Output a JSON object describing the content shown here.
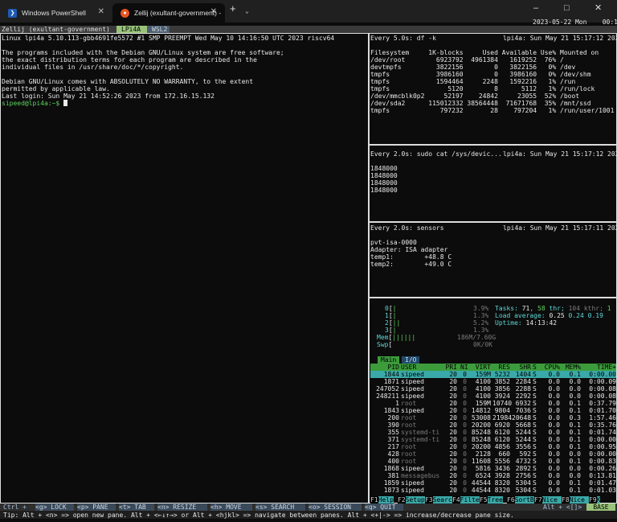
{
  "window": {
    "tabs": [
      {
        "label": "Windows PowerShell"
      },
      {
        "label": "Zellij (exultant-government) -"
      }
    ],
    "datetime": "2023-05-22 Mon    00:17"
  },
  "zellij": {
    "session": "Zellij (exultant-government)",
    "tabs": [
      "LPi4A",
      "WSL2"
    ]
  },
  "left_pane": {
    "lines": [
      "Linux lpi4a 5.10.113-gbb4691fe5572 #1 SMP PREEMPT Wed May 10 14:16:50 UTC 2023 riscv64",
      "",
      "The programs included with the Debian GNU/Linux system are free software;",
      "the exact distribution terms for each program are described in the",
      "individual files in /usr/share/doc/*/copyright.",
      "",
      "Debian GNU/Linux comes with ABSOLUTELY NO WARRANTY, to the extent",
      "permitted by applicable law.",
      "Last login: Sun May 21 14:52:26 2023 from 172.16.15.132"
    ],
    "prompt": "sipeed@lpi4a:~$ "
  },
  "df_pane": {
    "header_left": "Every 5.0s: df -k",
    "header_right": "lpi4a: Sun May 21 15:17:12 2023",
    "lines": [
      "Filesystem     1K-blocks     Used Available Use% Mounted on",
      "/dev/root        6923792  4961384   1619252  76% /",
      "devtmpfs         3822156        0   3822156   0% /dev",
      "tmpfs            3986160        0   3986160   0% /dev/shm",
      "tmpfs            1594464     2248   1592216   1% /run",
      "tmpfs               5120        8      5112   1% /run/lock",
      "/dev/mmcblk0p2     52197    24842     23055  52% /boot",
      "/dev/sda2      115012332 38564448  71671768  35% /mnt/ssd",
      "tmpfs             797232       28    797204   1% /run/user/1001"
    ]
  },
  "cat_pane": {
    "header_left": "Every 2.0s: sudo cat /sys/devic...",
    "header_right": "lpi4a: Sun May 21 15:17:12 2023",
    "lines": [
      "1848000",
      "1848000",
      "1848000",
      "1848000"
    ]
  },
  "sensors_pane": {
    "header_left": "Every 2.0s: sensors",
    "header_right": "lpi4a: Sun May 21 15:17:11 2023",
    "lines": [
      "pvt-isa-0000",
      "Adapter: ISA adapter",
      "temp1:        +48.8 C",
      "temp2:        +49.0 C"
    ]
  },
  "htop": {
    "cpus": [
      {
        "label": "0",
        "bar": "|",
        "value": "3.9%"
      },
      {
        "label": "1",
        "bar": "|",
        "value": "1.3%"
      },
      {
        "label": "2",
        "bar": "||",
        "value": "5.2%"
      },
      {
        "label": "3",
        "bar": "|",
        "value": "1.3%"
      }
    ],
    "mem": {
      "label": "Mem",
      "bar": "||||||",
      "value": "186M/7.60G"
    },
    "swp": {
      "label": "Swp",
      "bar": "",
      "value": "0K/0K"
    },
    "tasks_label": "Tasks:",
    "tasks": "71",
    "thr": "58",
    "thr_label": "thr;",
    "kthr": "104 kthr;",
    "running": "1",
    "load_label": "Load average:",
    "load1": "0.25",
    "load5": "0.24",
    "load15": "0.19",
    "uptime_label": "Uptime:",
    "uptime": "14:13:42",
    "tabs": [
      "Main",
      "I/O"
    ],
    "columns": [
      "PID",
      "USER",
      "PRI",
      "NI",
      "VIRT",
      "RES",
      "SHR",
      "S",
      "CPU%",
      "MEM%",
      "TIME+"
    ],
    "processes": [
      [
        "1844",
        "sipeed",
        "20",
        "0",
        "159M",
        "5232",
        "1404",
        "S",
        "0.0",
        "0.1",
        "0:00.00"
      ],
      [
        "1871",
        "sipeed",
        "20",
        "0",
        "4100",
        "3852",
        "2284",
        "S",
        "0.0",
        "0.0",
        "0:00.09"
      ],
      [
        "247052",
        "sipeed",
        "20",
        "0",
        "4100",
        "3856",
        "2288",
        "S",
        "0.0",
        "0.0",
        "0:00.08"
      ],
      [
        "248211",
        "sipeed",
        "20",
        "0",
        "4100",
        "3924",
        "2292",
        "S",
        "0.0",
        "0.0",
        "0:00.08"
      ],
      [
        "1",
        "root",
        "20",
        "0",
        "159M",
        "10740",
        "6932",
        "S",
        "0.0",
        "0.1",
        "0:37.79"
      ],
      [
        "1843",
        "sipeed",
        "20",
        "0",
        "14812",
        "9804",
        "7036",
        "S",
        "0.0",
        "0.1",
        "0:01.70"
      ],
      [
        "200",
        "root",
        "20",
        "0",
        "53008",
        "21984",
        "20648",
        "S",
        "0.0",
        "0.3",
        "1:57.46"
      ],
      [
        "390",
        "root",
        "20",
        "0",
        "20200",
        "6920",
        "5668",
        "S",
        "0.0",
        "0.1",
        "0:35.76"
      ],
      [
        "355",
        "systemd-ti",
        "20",
        "0",
        "85248",
        "6120",
        "5244",
        "S",
        "0.0",
        "0.1",
        "0:01.74"
      ],
      [
        "371",
        "systemd-ti",
        "20",
        "0",
        "85248",
        "6120",
        "5244",
        "S",
        "0.0",
        "0.1",
        "0:00.00"
      ],
      [
        "217",
        "root",
        "20",
        "0",
        "20200",
        "4856",
        "3556",
        "S",
        "0.0",
        "0.1",
        "0:00.95"
      ],
      [
        "428",
        "root",
        "20",
        "0",
        "2128",
        "660",
        "592",
        "S",
        "0.0",
        "0.0",
        "0:00.00"
      ],
      [
        "400",
        "root",
        "20",
        "0",
        "11608",
        "5556",
        "4732",
        "S",
        "0.0",
        "0.1",
        "0:00.83"
      ],
      [
        "1868",
        "sipeed",
        "20",
        "0",
        "5816",
        "3436",
        "2892",
        "S",
        "0.0",
        "0.0",
        "0:00.26"
      ],
      [
        "381",
        "messagebus",
        "20",
        "0",
        "6524",
        "3928",
        "2756",
        "S",
        "0.0",
        "0.0",
        "0:13.81"
      ],
      [
        "1859",
        "sipeed",
        "20",
        "0",
        "44544",
        "8320",
        "5304",
        "S",
        "0.0",
        "0.1",
        "0:01.47"
      ],
      [
        "1873",
        "sipeed",
        "20",
        "0",
        "44544",
        "8320",
        "5304",
        "S",
        "0.0",
        "0.1",
        "0:01.03"
      ]
    ],
    "fkeys": [
      {
        "num": "F1",
        "label": "Help"
      },
      {
        "num": "F2",
        "label": "Setup"
      },
      {
        "num": "F3",
        "label": "Search"
      },
      {
        "num": "F4",
        "label": "Filter"
      },
      {
        "num": "F5",
        "label": "Tree"
      },
      {
        "num": "F6",
        "label": "SortBy"
      },
      {
        "num": "F7",
        "label": "Nice -"
      },
      {
        "num": "F8",
        "label": "Nice +"
      },
      {
        "num": "F9",
        "label": "K"
      }
    ]
  },
  "modebar": {
    "items": [
      {
        "key": "Ctrl +",
        "plain": true
      },
      {
        "key": "<g>",
        "label": "LOCK"
      },
      {
        "key": "<p>",
        "label": "PANE"
      },
      {
        "key": "<t>",
        "label": "TAB"
      },
      {
        "key": "<n>",
        "label": "RESIZE"
      },
      {
        "key": "<h>",
        "label": "MOVE"
      },
      {
        "key": "<s>",
        "label": "SEARCH"
      },
      {
        "key": "<o>",
        "label": "SESSION"
      },
      {
        "key": "<q>",
        "label": "QUIT"
      }
    ],
    "right_label": "Alt + <[]>",
    "right_mode": "BASE"
  },
  "tip": "Tip: Alt + <n> => open new pane. Alt + <←↓↑→> or Alt + <hjkl> => navigate between panes. Alt + <+|-> => increase/decrease pane size."
}
